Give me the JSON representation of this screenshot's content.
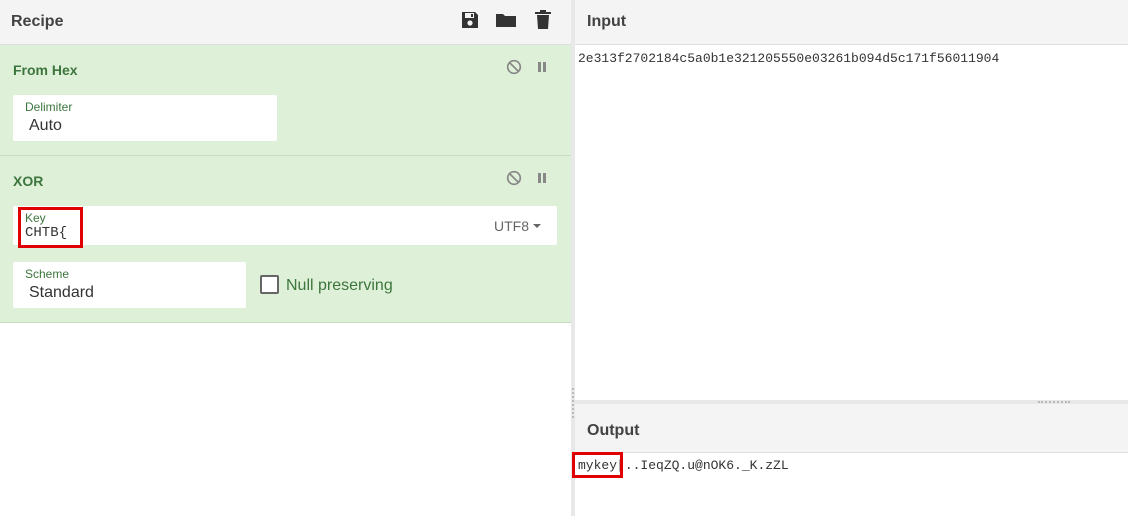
{
  "recipe": {
    "title": "Recipe",
    "icons": [
      "save-icon",
      "folder-open-icon",
      "trash-icon"
    ]
  },
  "operations": [
    {
      "name": "From Hex",
      "controls": [
        "disable-icon",
        "pause-icon"
      ],
      "delimiter_label": "Delimiter",
      "delimiter_value": "Auto"
    },
    {
      "name": "XOR",
      "controls": [
        "disable-icon",
        "pause-icon"
      ],
      "key_label": "Key",
      "key_value": "CHTB{",
      "key_encoding": "UTF8",
      "scheme_label": "Scheme",
      "scheme_value": "Standard",
      "null_preserving_label": "Null preserving",
      "null_preserving_checked": false
    }
  ],
  "input": {
    "title": "Input",
    "text": "2e313f2702184c5a0b1e321205550e03261b094d5c171f56011904"
  },
  "output": {
    "title": "Output",
    "text_highlighted": "mykey",
    "text_rest": "[..IeqZQ.u@nOK6._K.zZL"
  },
  "colors": {
    "operation_bg": "#dff0d8",
    "operation_text": "#3c763d",
    "highlight": "#e00000"
  }
}
